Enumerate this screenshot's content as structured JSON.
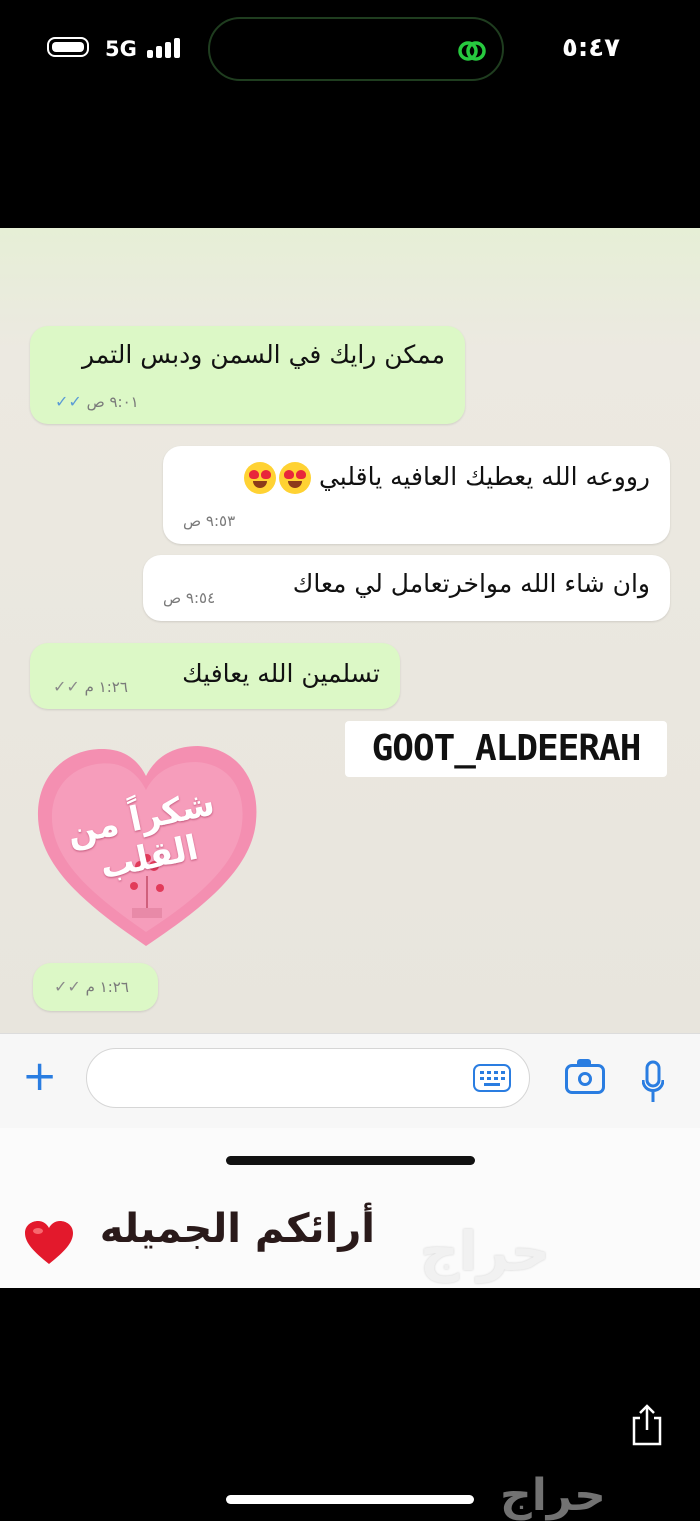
{
  "status_bar": {
    "network": "5G",
    "time": "٥:٤٧"
  },
  "chat": {
    "messages": [
      {
        "text": "ممكن رايك في السمن ودبس التمر",
        "time": "٩:٠١ ص",
        "direction": "outgoing"
      },
      {
        "text": "رووعه الله يعطيك العافيه ياقلبي",
        "time": "٩:٥٣ ص",
        "direction": "incoming"
      },
      {
        "text": "وان شاء الله مواخرتعامل لي معاك",
        "time": "٩:٥٤ ص",
        "direction": "incoming"
      },
      {
        "text": "تسلمين الله يعافيك",
        "time": "١:٢٦ م",
        "direction": "outgoing"
      }
    ],
    "overlay_tag": "GOOT_ALDEERAH",
    "sticker": {
      "text": "شكراً من القلب",
      "time": "١:٢٦ م"
    }
  },
  "caption": "أرائكم الجميله",
  "watermark": "حراج",
  "colors": {
    "outgoing_bubble": "#dcf8c6",
    "incoming_bubble": "#ffffff",
    "accent": "#2a7de1",
    "tick_read": "#5b9bd5"
  },
  "icons": [
    "battery-icon",
    "signal-icon",
    "island-app-icon",
    "plus-icon",
    "keyboard-icon",
    "camera-icon",
    "microphone-icon",
    "share-icon",
    "heart-icon"
  ]
}
